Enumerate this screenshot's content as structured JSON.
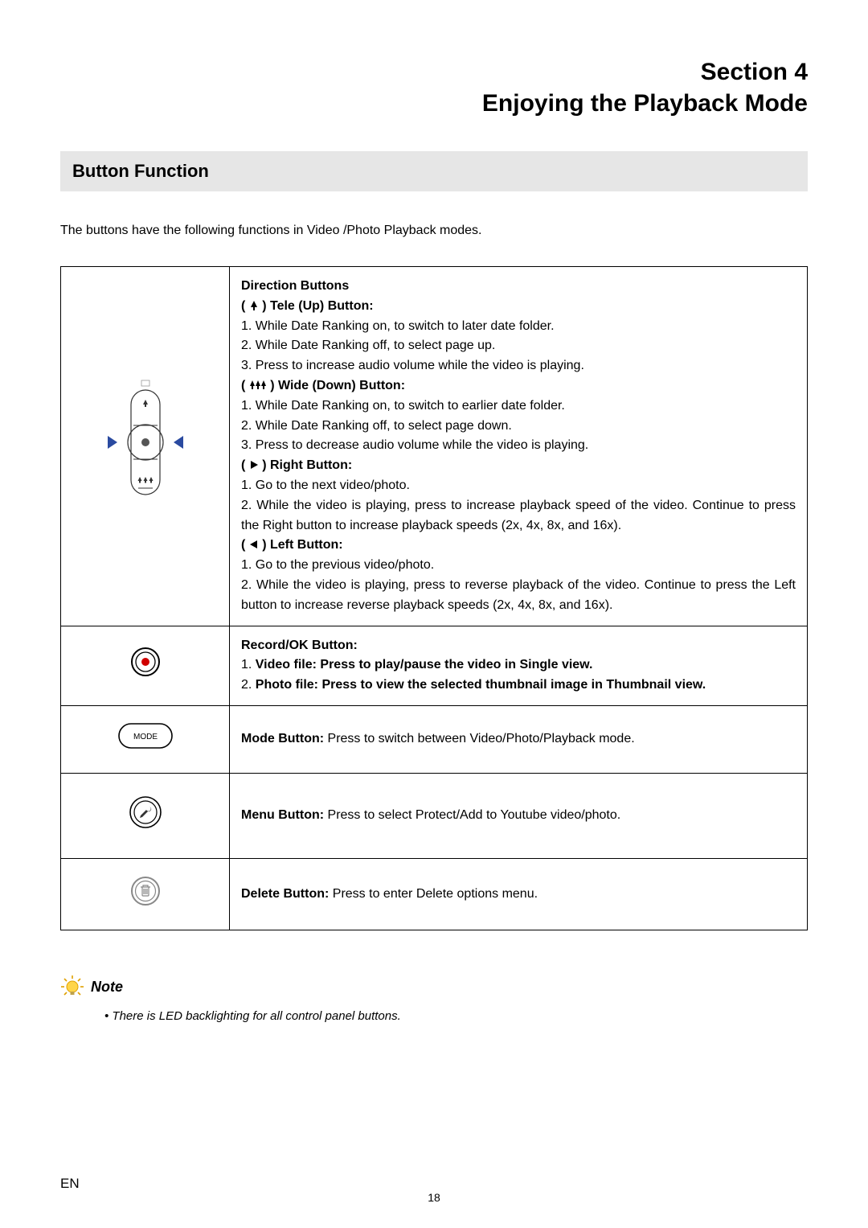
{
  "header": {
    "section": "Section 4",
    "title": "Enjoying the Playback Mode"
  },
  "sub_heading": "Button Function",
  "intro": "The buttons have the following functions in Video /Photo Playback modes.",
  "direction": {
    "heading": "Direction Buttons",
    "tele_label": " ) Tele (Up) Button:",
    "tele_paren": "( ",
    "tele_1": "1. While Date Ranking on, to switch to later date folder.",
    "tele_2": "2. While Date Ranking off, to select page up.",
    "tele_3": "3. Press to increase audio volume while the video is playing.",
    "wide_paren": "( ",
    "wide_label": " ) Wide (Down) Button:",
    "wide_1": "1. While Date Ranking on, to switch to earlier date folder.",
    "wide_2": "2. While Date Ranking off, to select page down.",
    "wide_3": "3. Press to decrease audio volume while the video is playing.",
    "right_paren": "( ",
    "right_label": " ) Right Button:",
    "right_1": "1. Go to the next video/photo.",
    "right_2": "2. While the video is playing, press to increase playback speed of the video. Continue to press the Right button to increase playback speeds (2x, 4x, 8x, and 16x).",
    "left_paren": "( ",
    "left_label": " ) Left Button:",
    "left_1": "1. Go to the previous video/photo.",
    "left_2": "2. While the video is playing, press to reverse playback of the video.  Continue to press the Left button to increase reverse playback speeds (2x, 4x, 8x, and 16x)."
  },
  "record": {
    "heading": "Record/OK Button:",
    "line1_prefix": "1. ",
    "line1_bold": "Video file: Press to play/pause the video in Single view.",
    "line2_prefix": "2. ",
    "line2_bold": "Photo file: Press to view the selected thumbnail image in Thumbnail view."
  },
  "mode": {
    "bold": "Mode Button: ",
    "rest": "Press to switch between Video/Photo/Playback mode."
  },
  "menu": {
    "bold": "Menu Button: ",
    "rest": "Press to select Protect/Add to Youtube video/photo."
  },
  "del": {
    "bold": "Delete Button: ",
    "rest": "Press to enter Delete options menu."
  },
  "note": {
    "title": "Note",
    "bullet": "•  There is LED backlighting for all control panel buttons."
  },
  "footer": {
    "en": "EN",
    "page": "18"
  }
}
